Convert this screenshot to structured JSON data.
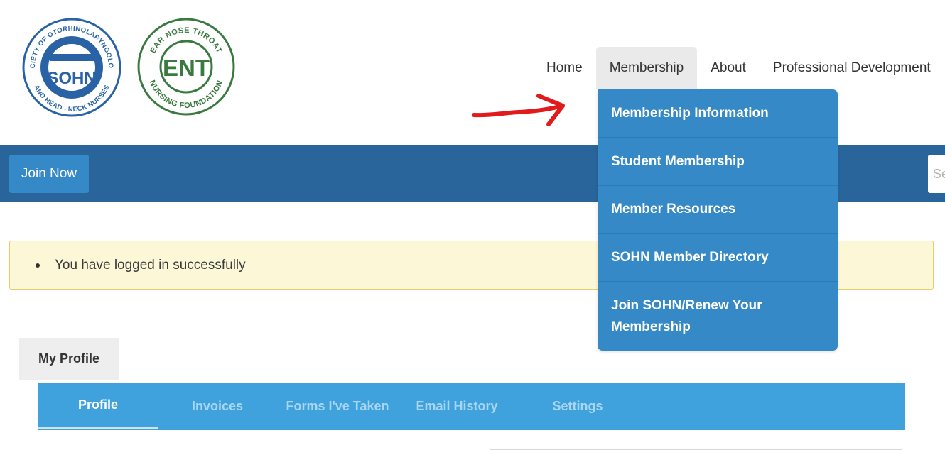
{
  "logos": {
    "sohn": {
      "alt": "Society of Otorhinolaryngology and Head-Neck Nurses logo",
      "ring_top_text": "SOCIETY OF OTORHINOLARYNGOLOGY",
      "ring_bottom_text": "AND HEAD - NECK NURSES",
      "center_text": "SOHN",
      "color": "#2a63a5"
    },
    "ent": {
      "alt": "Ear Nose Throat Nursing Foundation logo",
      "ring_top_text": "EAR NOSE THROAT",
      "ring_bottom_text": "NURSING FOUNDATION",
      "center_text": "ENT",
      "color": "#3a7a40"
    }
  },
  "nav": {
    "items": [
      {
        "label": "Home",
        "active": false
      },
      {
        "label": "Membership",
        "active": true
      },
      {
        "label": "About",
        "active": false
      },
      {
        "label": "Professional Development",
        "active": false
      }
    ]
  },
  "dropdown": {
    "items": [
      {
        "label": "Membership Information"
      },
      {
        "label": "Student Membership"
      },
      {
        "label": "Member Resources"
      },
      {
        "label": "SOHN Member Directory"
      },
      {
        "label": "Join SOHN/Renew Your Membership"
      }
    ]
  },
  "band": {
    "join_label": "Join Now",
    "search_placeholder": "Search"
  },
  "alert": {
    "message": "You have logged in successfully"
  },
  "profile": {
    "heading": "My Profile",
    "tabs": [
      {
        "label": "Profile",
        "active": true
      },
      {
        "label": "Invoices",
        "active": false
      },
      {
        "label": "Forms I've Taken",
        "active": false
      },
      {
        "label": "Email History",
        "active": false
      },
      {
        "label": "Settings",
        "active": false
      }
    ]
  },
  "annotation": {
    "icon": "red-arrow-icon",
    "color": "#e11b1b"
  },
  "colors": {
    "band": "#29659b",
    "dropdown": "#3589c6",
    "tabs": "#3fa2dd",
    "alert_bg": "#fcf8d7",
    "alert_border": "#e5cd6a"
  }
}
